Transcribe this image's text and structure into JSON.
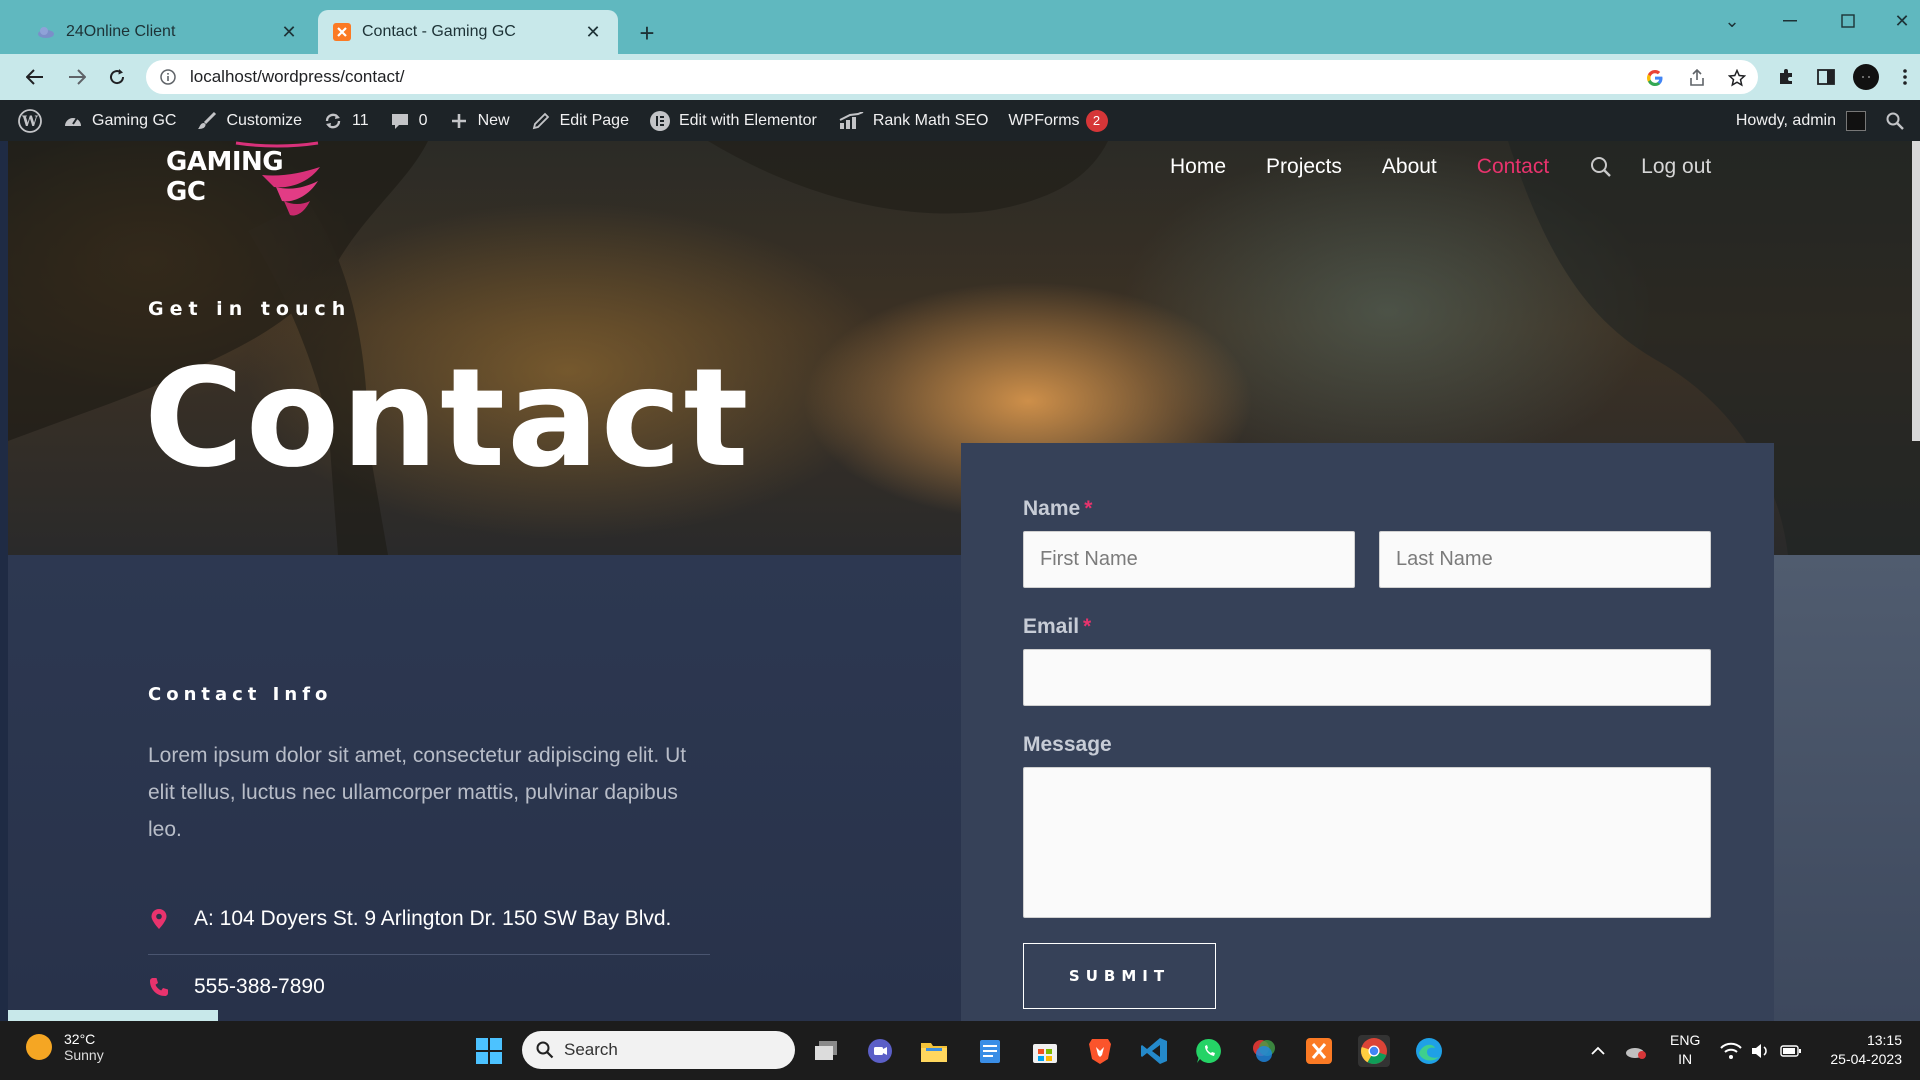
{
  "browser": {
    "tabs": [
      {
        "title": "24Online Client"
      },
      {
        "title": "Contact - Gaming GC"
      }
    ],
    "url": "localhost/wordpress/contact/"
  },
  "wp_admin_bar": {
    "site_name": "Gaming GC",
    "customize": "Customize",
    "updates_count": "11",
    "comments_count": "0",
    "new": "New",
    "edit_page": "Edit Page",
    "edit_elementor": "Edit with Elementor",
    "rank_math": "Rank Math SEO",
    "wpforms": "WPForms",
    "wpforms_badge": "2",
    "howdy": "Howdy, admin"
  },
  "site": {
    "logo_text": "GAMING GC",
    "nav": [
      "Home",
      "Projects",
      "About",
      "Contact"
    ],
    "active_nav": "Contact",
    "logout": "Log out",
    "accent_color": "#e8336d"
  },
  "hero": {
    "subtitle": "Get in touch",
    "heading": "Contact"
  },
  "contact_info": {
    "title": "Contact Info",
    "description": "Lorem ipsum dolor sit amet, consectetur adipiscing elit. Ut elit tellus, luctus nec ullamcorper mattis, pulvinar dapibus leo.",
    "address": "A: 104 Doyers St. 9 Arlington Dr. 150 SW Bay Blvd.",
    "phone": "555-388-7890"
  },
  "form": {
    "name_label": "Name",
    "first_name_placeholder": "First Name",
    "last_name_placeholder": "Last Name",
    "email_label": "Email",
    "message_label": "Message",
    "required_mark": "*",
    "submit": "SUBMIT"
  },
  "taskbar": {
    "temperature": "32°C",
    "weather": "Sunny",
    "search_placeholder": "Search",
    "lang1": "ENG",
    "lang2": "IN",
    "time": "13:15",
    "date": "25-04-2023"
  }
}
